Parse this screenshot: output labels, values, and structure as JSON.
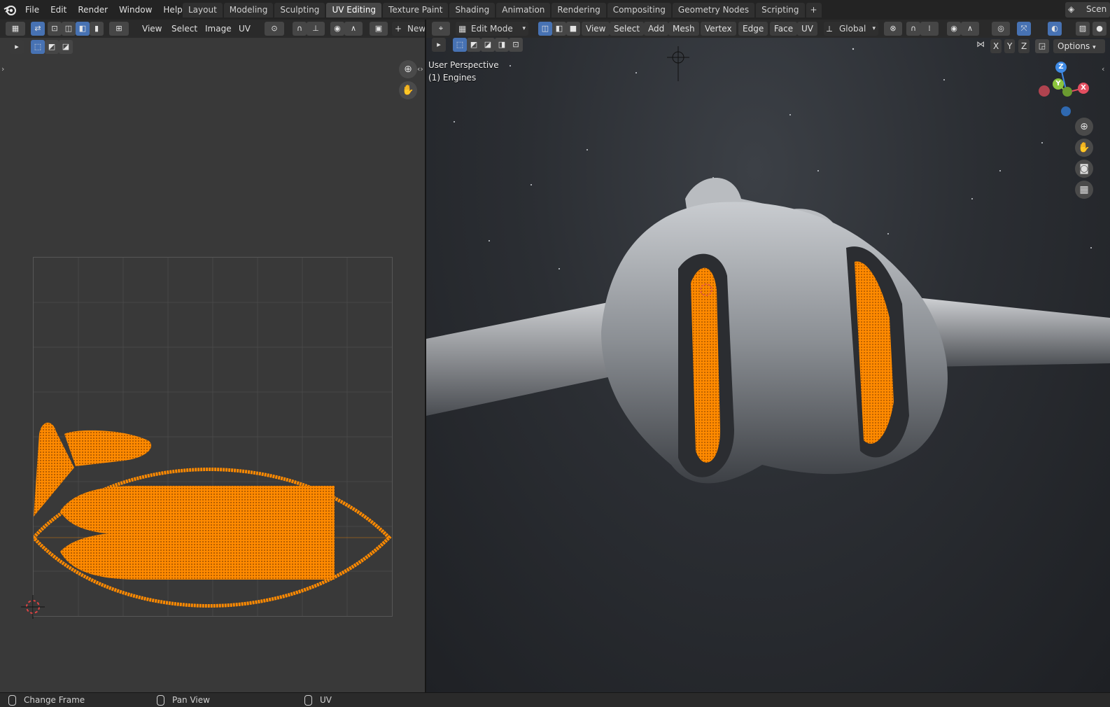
{
  "topbar": {
    "menus": [
      "File",
      "Edit",
      "Render",
      "Window",
      "Help"
    ],
    "workspaces": [
      {
        "label": "Layout",
        "active": false
      },
      {
        "label": "Modeling",
        "active": false
      },
      {
        "label": "Sculpting",
        "active": false
      },
      {
        "label": "UV Editing",
        "active": true
      },
      {
        "label": "Texture Paint",
        "active": false
      },
      {
        "label": "Shading",
        "active": false
      },
      {
        "label": "Animation",
        "active": false
      },
      {
        "label": "Rendering",
        "active": false
      },
      {
        "label": "Compositing",
        "active": false
      },
      {
        "label": "Geometry Nodes",
        "active": false
      },
      {
        "label": "Scripting",
        "active": false
      }
    ],
    "add_tab": "+",
    "scene_label": "Scen"
  },
  "uv_editor": {
    "menus": [
      "View",
      "Select",
      "Image",
      "UV"
    ],
    "new_button": "New",
    "new_icon": "plus-icon"
  },
  "viewport": {
    "mode": "Edit Mode",
    "menus": [
      "View",
      "Select",
      "Add",
      "Mesh",
      "Vertex",
      "Edge",
      "Face",
      "UV"
    ],
    "orientation": "Global",
    "axis_lock": [
      "X",
      "Y",
      "Z"
    ],
    "options_label": "Options",
    "perspective_label": "User Perspective",
    "object_label": "(1) Engines",
    "gizmo": {
      "z": "Z",
      "y": "Y",
      "x": "X"
    }
  },
  "statusbar": {
    "items": [
      "Change Frame",
      "Pan View",
      "UV"
    ]
  },
  "colors": {
    "selection_orange": "#ff8a00",
    "active_blue": "#4772b3",
    "axis_x": "#e34e60",
    "axis_y": "#8cc63e",
    "axis_z": "#3f8be5"
  }
}
